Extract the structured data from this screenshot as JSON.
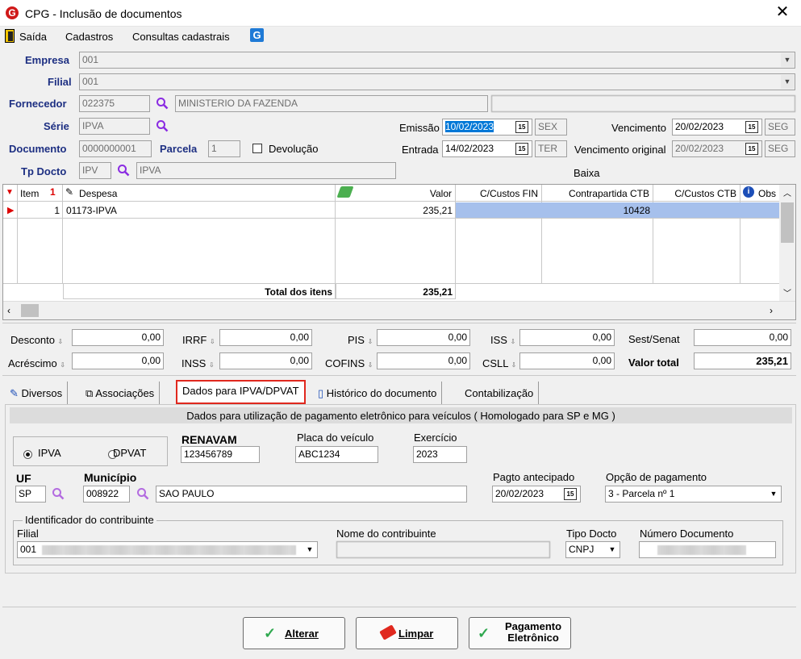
{
  "window": {
    "title": "CPG - Inclusão de documentos",
    "app_icon": "G",
    "close": "✕"
  },
  "menu": {
    "items": [
      "Saída",
      "Cadastros",
      "Consultas cadastrais"
    ]
  },
  "header": {
    "empresa_label": "Empresa",
    "empresa_value": "001",
    "filial_label": "Filial",
    "filial_value": "001",
    "fornecedor_label": "Fornecedor",
    "fornecedor_code": "022375",
    "fornecedor_name": "MINISTERIO DA FAZENDA",
    "serie_label": "Série",
    "serie_value": "IPVA",
    "documento_label": "Documento",
    "documento_value": "0000000001",
    "parcela_label": "Parcela",
    "parcela_value": "1",
    "devolucao_label": "Devolução",
    "tpdocto_label": "Tp Docto",
    "tpdocto_code": "IPV",
    "tpdocto_name": "IPVA",
    "emissao_label": "Emissão",
    "emissao_value": "10/02/2023",
    "emissao_day": "SEX",
    "entrada_label": "Entrada",
    "entrada_value": "14/02/2023",
    "entrada_day": "TER",
    "vencimento_label": "Vencimento",
    "vencimento_value": "20/02/2023",
    "vencimento_day": "SEG",
    "venc_original_label": "Vencimento original",
    "venc_original_value": "20/02/2023",
    "venc_original_day": "SEG",
    "baixa_label": "Baixa",
    "cal_icon": "15"
  },
  "grid": {
    "columns": [
      "Item",
      "Despesa",
      "Valor",
      "C/Custos FIN",
      "Contrapartida CTB",
      "C/Custos CTB",
      "Obs"
    ],
    "row": {
      "item": "1",
      "despesa": "01173-IPVA",
      "valor": "235,21",
      "contrapartida": "10428"
    },
    "total_label": "Total dos itens",
    "total_value": "235,21"
  },
  "totals": {
    "desconto_label": "Desconto",
    "desconto": "0,00",
    "irrf_label": "IRRF",
    "irrf": "0,00",
    "pis_label": "PIS",
    "pis": "0,00",
    "iss_label": "ISS",
    "iss": "0,00",
    "sest_label": "Sest/Senat",
    "sest": "0,00",
    "acrescimo_label": "Acréscimo",
    "acrescimo": "0,00",
    "inss_label": "INSS",
    "inss": "0,00",
    "cofins_label": "COFINS",
    "cofins": "0,00",
    "csll_label": "CSLL",
    "csll": "0,00",
    "valor_total_label": "Valor total",
    "valor_total": "235,21"
  },
  "tabs": [
    "Diversos",
    "Associações",
    "Dados para IPVA/DPVAT",
    "Histórico do documento",
    "Contabilização"
  ],
  "ipva": {
    "section_title": "Dados para utilização de pagamento eletrônico para veículos ( Homologado para  SP e MG )",
    "radio_ipva": "IPVA",
    "radio_dpvat": "DPVAT",
    "renavam_label": "RENAVAM",
    "renavam_value": "123456789",
    "placa_label": "Placa do veículo",
    "placa_value": "ABC1234",
    "exercicio_label": "Exercício",
    "exercicio_value": "2023",
    "uf_label": "UF",
    "uf_value": "SP",
    "municipio_label": "Município",
    "municipio_code": "008922",
    "municipio_name": "SAO PAULO",
    "pagto_label": "Pagto antecipado",
    "pagto_value": "20/02/2023",
    "opcao_label": "Opção de pagamento",
    "opcao_value": "3 - Parcela nº 1",
    "ident_label": "Identificador do contribuinte",
    "filial_label": "Filial",
    "filial_value": "001",
    "nome_label": "Nome do contribuinte",
    "tipodocto_label": "Tipo Docto",
    "tipodocto_value": "CNPJ",
    "numdoc_label": "Número Documento"
  },
  "buttons": {
    "alterar": "Alterar",
    "limpar": "Limpar",
    "pagamento_line1": "Pagamento",
    "pagamento_line2": "Eletrônico"
  },
  "colors": {
    "accent_blue": "#1d2f82",
    "selection": "#0078d7",
    "row_highlight": "#a6c0ec",
    "tab_highlight": "#e0281e"
  }
}
